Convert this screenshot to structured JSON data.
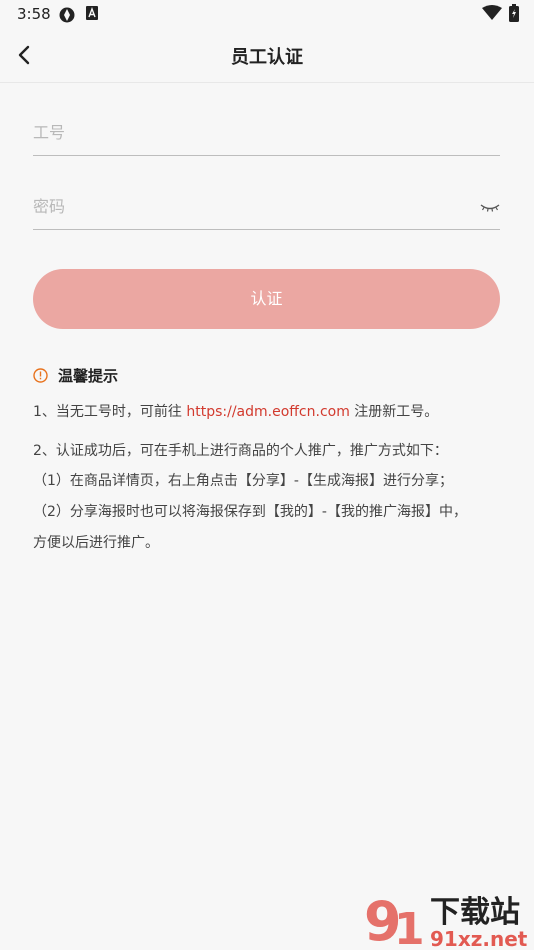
{
  "status_bar": {
    "time": "3:58"
  },
  "header": {
    "title": "员工认证"
  },
  "form": {
    "employee_id_placeholder": "工号",
    "password_placeholder": "密码",
    "submit_label": "认证"
  },
  "tips": {
    "title": "温馨提示",
    "line1_prefix": "1、当无工号时，可前往 ",
    "line1_link": "https://adm.eoffcn.com",
    "line1_suffix": " 注册新工号。",
    "line2": "2、认证成功后，可在手机上进行商品的个人推广，推广方式如下：",
    "line3": "（1）在商品详情页，右上角点击【分享】-【生成海报】进行分享；",
    "line4": "（2）分享海报时也可以将海报保存到【我的】-【我的推广海报】中，",
    "line5": "方便以后进行推广。"
  },
  "watermark": {
    "text_top": "下载站",
    "text_bottom": "91xz.net"
  },
  "colors": {
    "accent": "#eba7a2",
    "link": "#d23a2e",
    "warning": "#e8731e"
  }
}
